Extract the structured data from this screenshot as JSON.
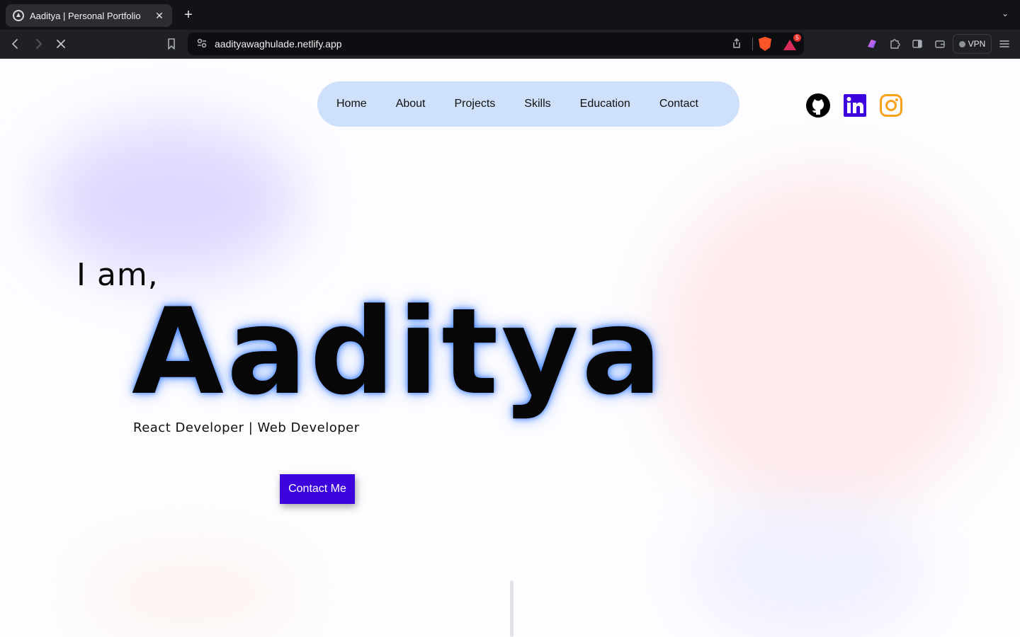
{
  "browser": {
    "tab": {
      "title": "Aaditya | Personal Portfolio",
      "close_glyph": "✕",
      "favicon": "portfolio-favicon"
    },
    "new_tab_glyph": "+",
    "tab_list_glyph": "⌄",
    "address": {
      "url": "aadityawaghulade.netlify.app"
    },
    "rewards_badge": "5",
    "vpn_label": "VPN",
    "icons": [
      "back-icon",
      "forward-icon",
      "stop-icon",
      "bookmark-icon",
      "site-info-icon",
      "share-icon",
      "brave-shield-icon",
      "rewards-icon",
      "leo-icon",
      "extensions-icon",
      "sidebar-icon",
      "wallet-icon",
      "menu-icon"
    ]
  },
  "nav": {
    "items": [
      "Home",
      "About",
      "Projects",
      "Skills",
      "Education",
      "Contact"
    ]
  },
  "social": [
    "github-icon",
    "linkedin-icon",
    "instagram-icon"
  ],
  "hero": {
    "greeting": "I am,",
    "name": "Aaditya",
    "role": "React Developer | Web Developer",
    "cta": "Contact Me"
  },
  "colors": {
    "nav_bg": "#cfe0fb",
    "cta_bg": "#3d05dd",
    "linkedin": "#3d05dd",
    "instagram": "#f8a21a",
    "name_glow": "#3078ff"
  }
}
